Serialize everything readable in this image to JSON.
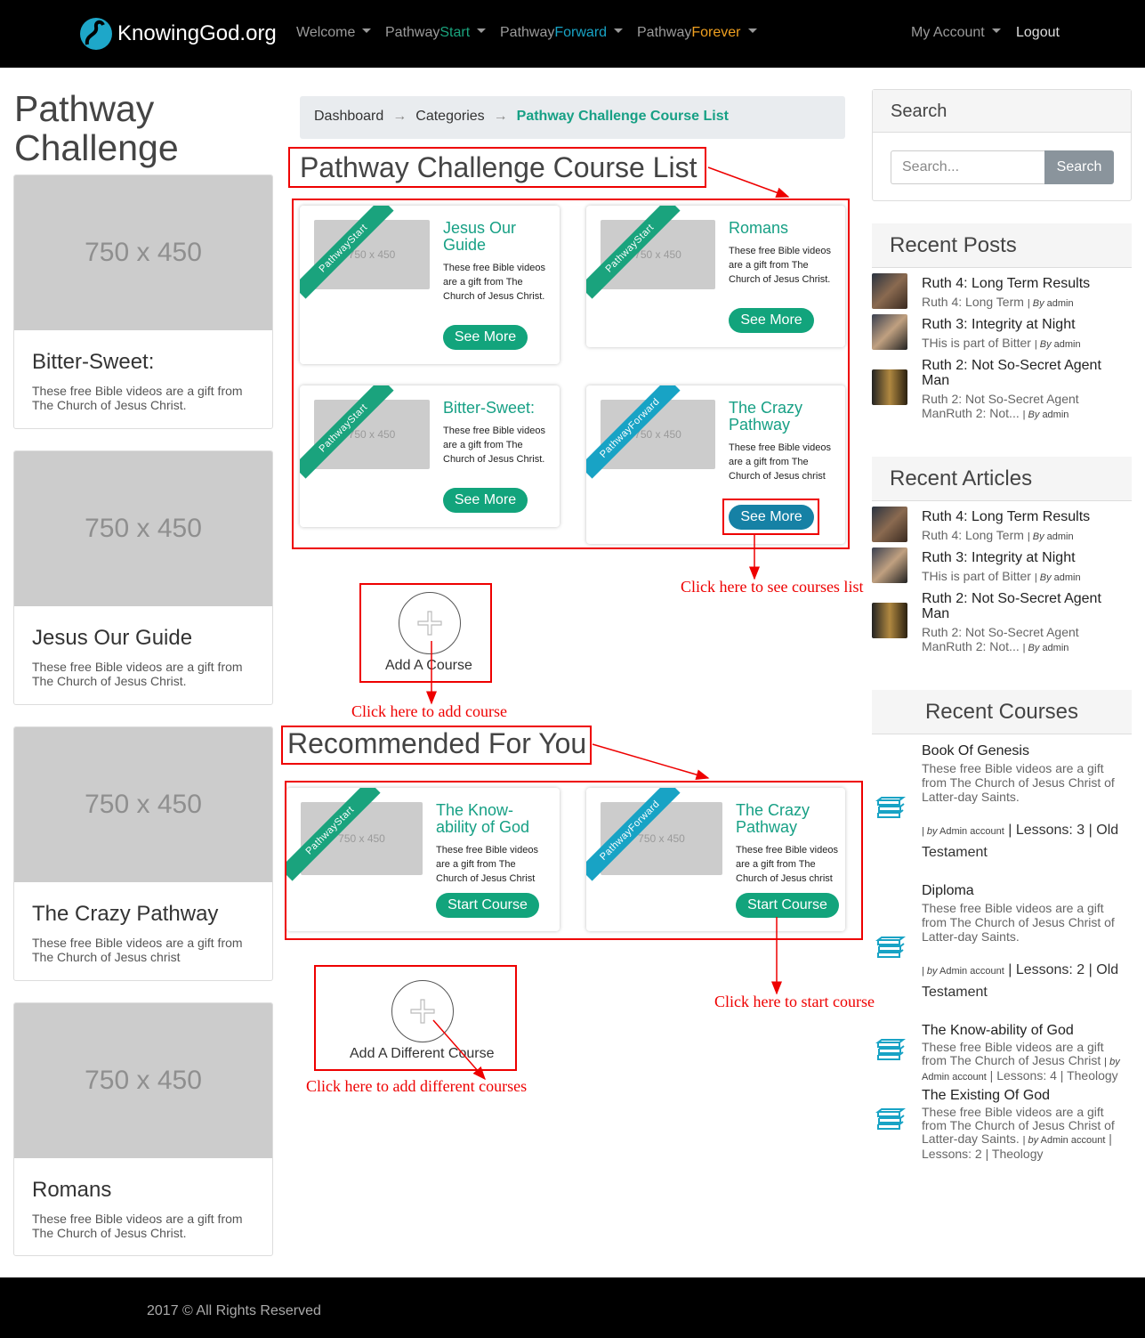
{
  "nav": {
    "logo_text": "KnowingGod.org",
    "items": [
      {
        "label": "Welcome"
      },
      {
        "prefix": "Pathway",
        "suffix": "Start"
      },
      {
        "prefix": "Pathway",
        "suffix": "Forward"
      },
      {
        "prefix": "Pathway",
        "suffix": "Forever"
      }
    ],
    "my_account": "My Account",
    "logout": "Logout",
    "colors": {
      "start": "#1aa37d",
      "forward": "#18a3c5",
      "forever": "#f0a020"
    }
  },
  "left": {
    "title": "Pathway Challenge",
    "cards": [
      {
        "placeholder": "750 x 450",
        "title": "Bitter-Sweet:",
        "desc": "These free Bible videos are a gift from The Church of Jesus Christ."
      },
      {
        "placeholder": "750 x 450",
        "title": "Jesus Our Guide",
        "desc": "These free Bible videos are a gift from The Church of Jesus Christ."
      },
      {
        "placeholder": "750 x 450",
        "title": "The Crazy Pathway",
        "desc": "These free Bible videos are a gift from The Church of Jesus christ"
      },
      {
        "placeholder": "750 x 450",
        "title": "Romans",
        "desc": "These free Bible videos are a gift from The Church of Jesus Christ."
      }
    ]
  },
  "breadcrumb": {
    "items": [
      "Dashboard",
      "Categories"
    ],
    "active": "Pathway Challenge Course List",
    "separator": "→"
  },
  "course_list": {
    "title": "Pathway Challenge Course List",
    "courses": [
      {
        "ribbon": "PathwayStart",
        "thumb": "750 x 450",
        "title": "Jesus Our Guide",
        "desc": "These free Bible videos are a gift from The Church of Jesus Christ.",
        "button": "See More"
      },
      {
        "ribbon": "PathwayStart",
        "thumb": "750 x 450",
        "title": "Romans",
        "desc": "These free Bible videos are a gift from The Church of Jesus Christ.",
        "button": "See More"
      },
      {
        "ribbon": "PathwayStart",
        "thumb": "750 x 450",
        "title": "Bitter-Sweet:",
        "desc": "These free Bible videos are a gift from The Church of Jesus Christ.",
        "button": "See More"
      },
      {
        "ribbon": "PathwayForward",
        "thumb": "750 x 450",
        "title": "The Crazy Pathway",
        "desc": "These free Bible videos are a gift from The Church of Jesus christ",
        "button": "See More"
      }
    ],
    "add_label": "Add A Course"
  },
  "recommended": {
    "title": "Recommended For You",
    "courses": [
      {
        "ribbon": "PathwayStart",
        "thumb": "750 x 450",
        "title": "The Know-ability of God",
        "desc": "These free Bible videos are a gift from The Church of Jesus Christ",
        "button": "Start Course"
      },
      {
        "ribbon": "PathwayForward",
        "thumb": "750 x 450",
        "title": "The Crazy Pathway",
        "desc": "These free Bible videos are a gift from The Church of Jesus christ",
        "button": "Start Course"
      }
    ],
    "add_label": "Add A Different Course"
  },
  "annotations": {
    "courses_list": "Click here to see courses list",
    "add_course": "Click here to add course",
    "start_course": "Click here to start course",
    "add_different": "Click here to add different courses"
  },
  "sidebar": {
    "search": {
      "title": "Search",
      "placeholder": "Search...",
      "button": "Search"
    },
    "recent_posts": {
      "title": "Recent Posts",
      "items": [
        {
          "title": "Ruth 4: Long Term Results",
          "sub": "Ruth 4: Long Term",
          "by": "By",
          "author": "admin"
        },
        {
          "title": "Ruth 3: Integrity at Night",
          "sub": "THis is part of Bitter",
          "by": "By",
          "author": "admin"
        },
        {
          "title": "Ruth 2: Not So-Secret Agent Man",
          "sub": "Ruth 2: Not So-Secret Agent ManRuth 2: Not...",
          "by": "By",
          "author": "admin"
        }
      ]
    },
    "recent_articles": {
      "title": "Recent Articles",
      "items": [
        {
          "title": "Ruth 4: Long Term Results",
          "sub": "Ruth 4: Long Term",
          "by": "By",
          "author": "admin"
        },
        {
          "title": "Ruth 3: Integrity at Night",
          "sub": "THis is part of Bitter",
          "by": "By",
          "author": "admin"
        },
        {
          "title": "Ruth 2: Not So-Secret Agent Man",
          "sub": "Ruth 2: Not So-Secret Agent ManRuth 2: Not...",
          "by": "By",
          "author": "admin"
        }
      ]
    },
    "recent_courses": {
      "title": "Recent Courses",
      "items": [
        {
          "title": "Book Of Genesis",
          "desc": "These free Bible videos are a gift from The Church of Jesus Christ of Latter-day Saints.",
          "by": "by",
          "author": "Admin account",
          "lessons": "Lessons: 3",
          "category": "Old Testament"
        },
        {
          "title": "Diploma",
          "desc": "These free Bible videos are a gift from The Church of Jesus Christ of Latter-day Saints.",
          "by": "by",
          "author": "Admin account",
          "lessons": "Lessons: 2",
          "category": "Old Testament"
        },
        {
          "title": "The Know-ability of God",
          "desc": "These free Bible videos are a gift from The Church of Jesus Christ",
          "by": "by",
          "author": "Admin account",
          "lessons": "Lessons: 4",
          "category": "Theology"
        },
        {
          "title": "The Existing Of God",
          "desc": "These free Bible videos are a gift from The Church of Jesus Christ of Latter-day Saints.",
          "by": "by",
          "author": "Admin account",
          "lessons": "Lessons: 2",
          "category": "Theology"
        }
      ]
    }
  },
  "footer": {
    "text": "2017 © All Rights Reserved"
  }
}
